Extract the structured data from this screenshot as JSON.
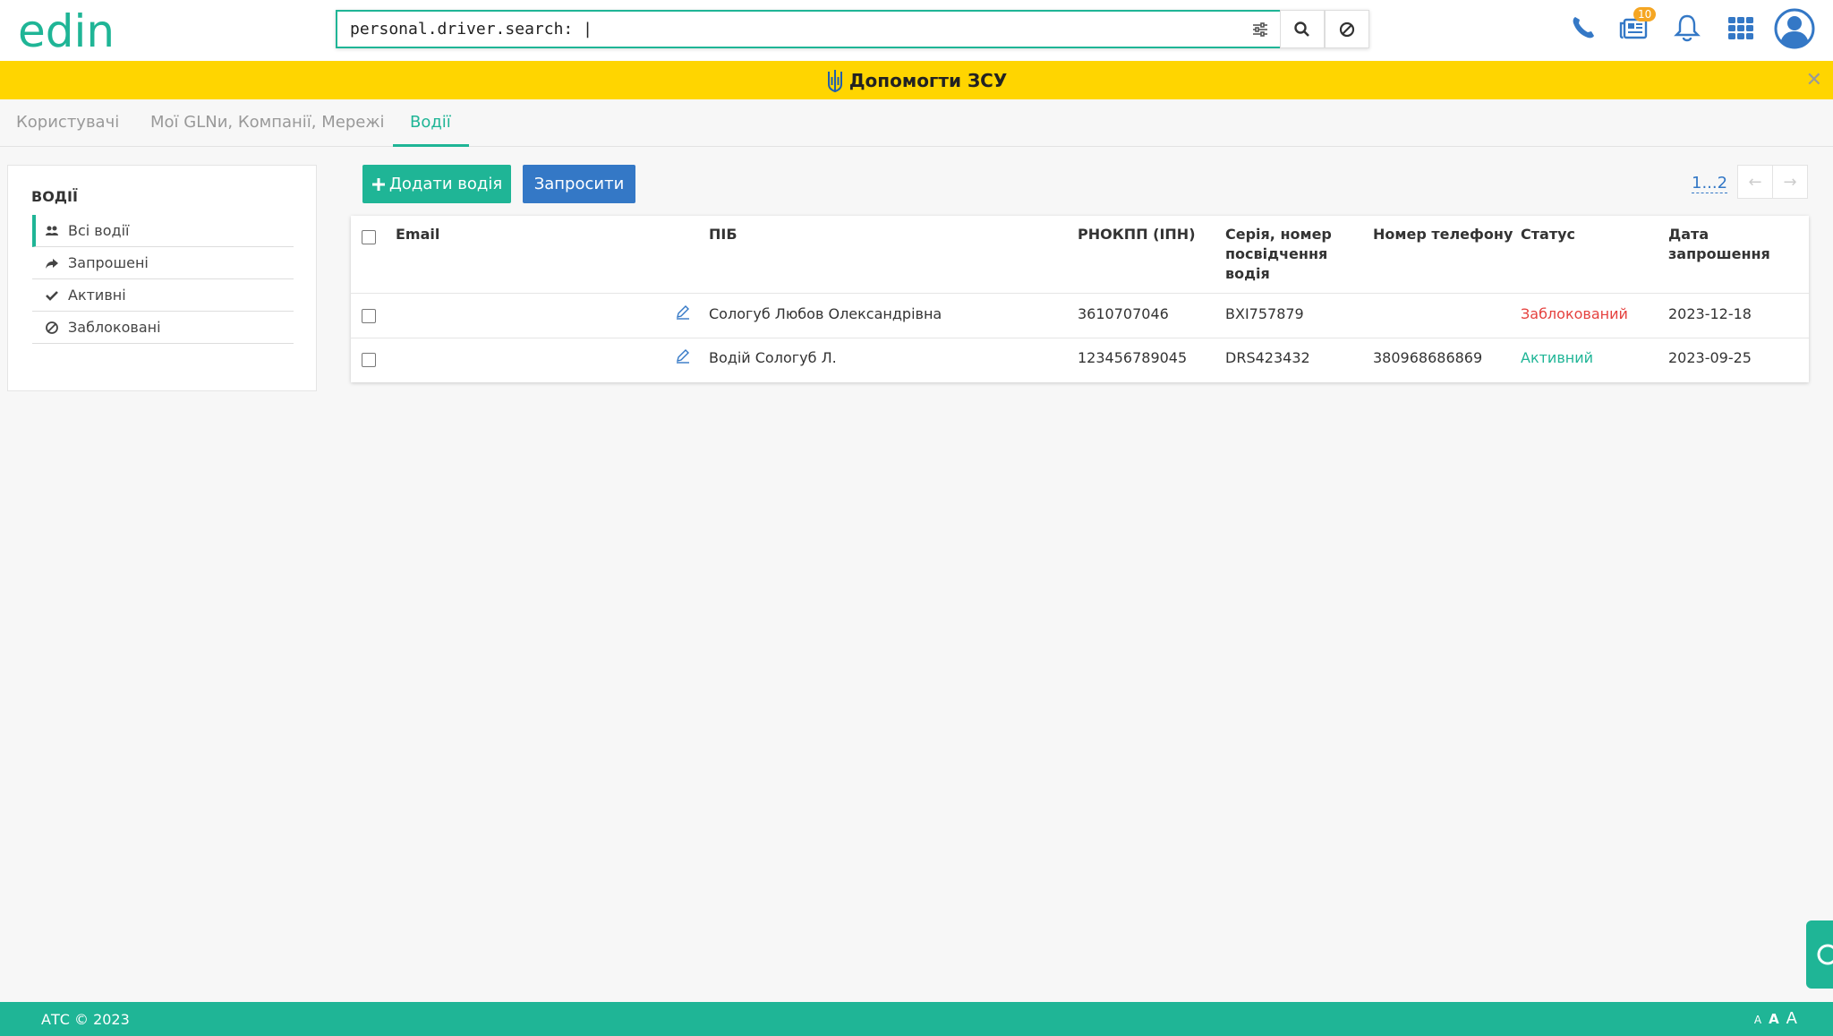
{
  "header": {
    "logo_text": "edin",
    "search": {
      "value": "personal.driver.search: |"
    },
    "notifications_badge": "10"
  },
  "banner": {
    "text": "Допомогти ЗСУ"
  },
  "tabs": [
    {
      "label": "Користувачі",
      "active": false
    },
    {
      "label": "Мої GLNи, Компанії, Мережі",
      "active": false
    },
    {
      "label": "Водії",
      "active": true
    }
  ],
  "sidebar": {
    "title": "ВОДІЇ",
    "items": [
      {
        "label": "Всі водії",
        "icon": "users-icon",
        "active": true
      },
      {
        "label": "Запрошені",
        "icon": "share-icon",
        "active": false
      },
      {
        "label": "Активні",
        "icon": "check-icon",
        "active": false
      },
      {
        "label": "Заблоковані",
        "icon": "ban-icon",
        "active": false
      }
    ]
  },
  "actions": {
    "add_driver": "Додати водія",
    "invite": "Запросити"
  },
  "pager": {
    "text": "1...2"
  },
  "table": {
    "columns": {
      "email": "Email",
      "name": "ПІБ",
      "tax_id": "РНОКПП (ІПН)",
      "license": "Серія, номер посвідчення водія",
      "phone": "Номер телефону",
      "status": "Статус",
      "invite_date": "Дата запрошення"
    },
    "rows": [
      {
        "email": "",
        "name": "Сологуб Любов Олександрівна",
        "tax_id": "3610707046",
        "license": "BXI757879",
        "phone": "",
        "status": "Заблокований",
        "invite_date": "2023-12-18"
      },
      {
        "email": "",
        "name": "Водій Сологуб Л.",
        "tax_id": "123456789045",
        "license": "DRS423432",
        "phone": "380968686869",
        "status": "Активний",
        "invite_date": "2023-09-25"
      }
    ]
  },
  "footer": {
    "copyright": "АТС © 2023",
    "font_small": "A",
    "font_medium": "A",
    "font_large": "A"
  },
  "colors": {
    "primary": "#1fb596",
    "secondary": "#3478c6",
    "banner": "#ffd500",
    "status_blocked": "#e5413e",
    "status_active": "#1fb596"
  }
}
